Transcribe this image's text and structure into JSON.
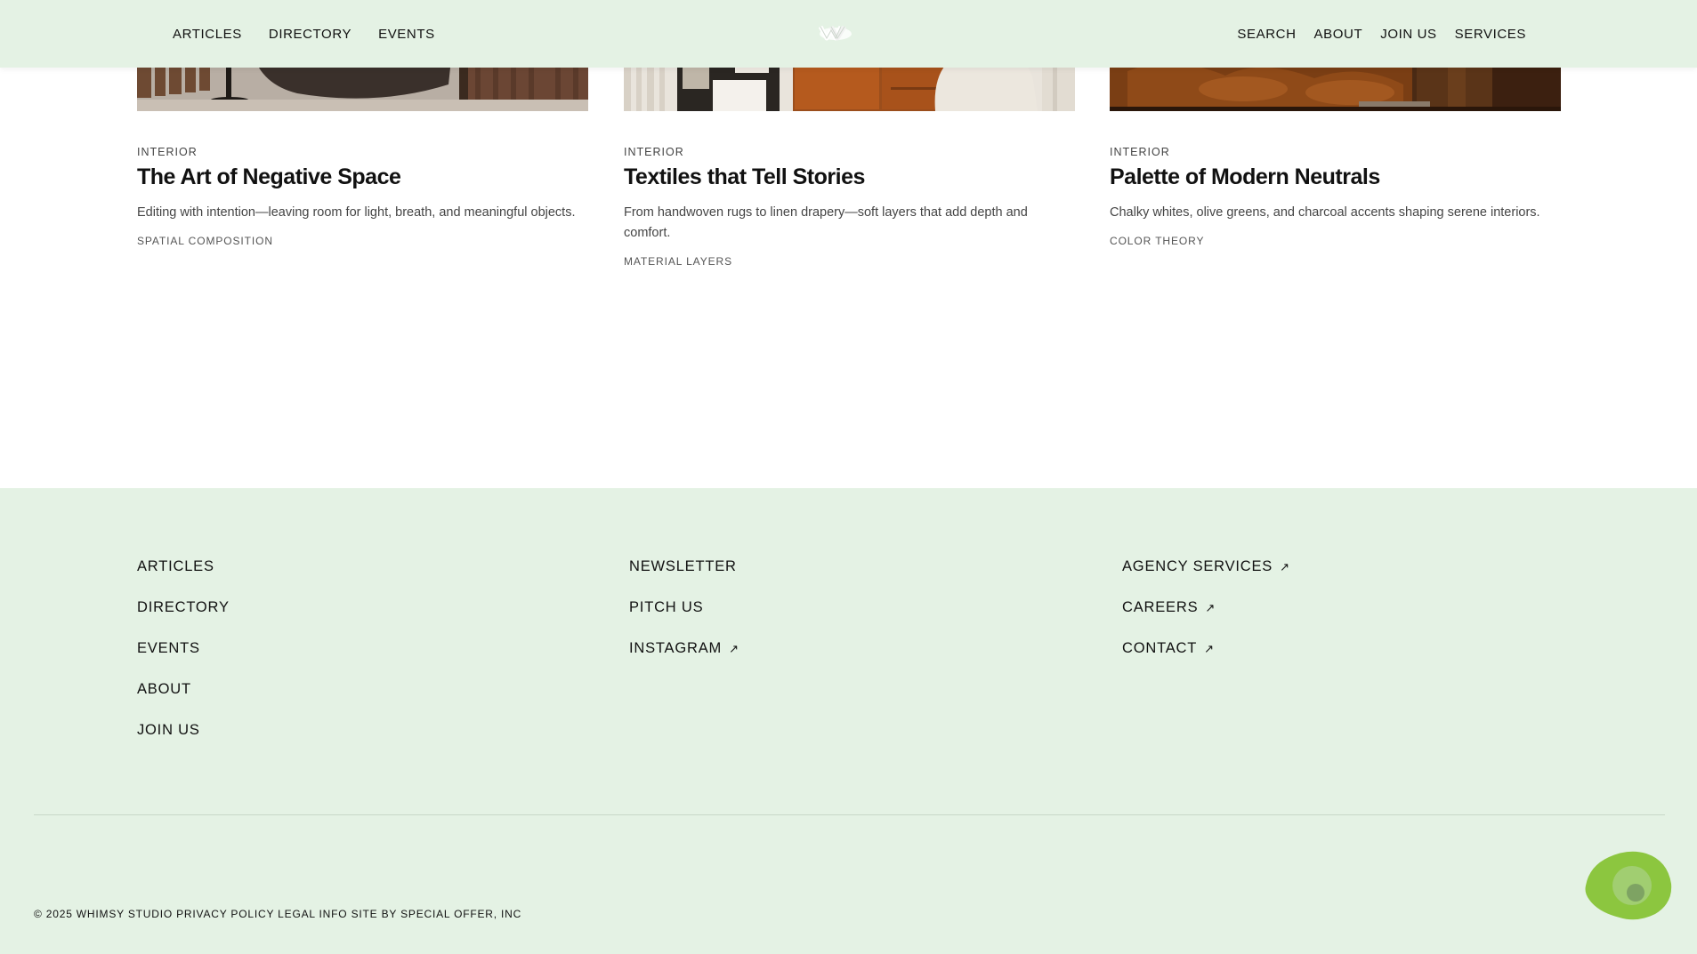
{
  "header": {
    "left_nav": [
      "ARTICLES",
      "DIRECTORY",
      "EVENTS"
    ],
    "right_nav": [
      "SEARCH",
      "ABOUT",
      "JOIN US",
      "SERVICES"
    ],
    "logo_icon": "w-monogram-logo"
  },
  "cards": [
    {
      "category": "INTERIOR",
      "title": "The Art of Negative Space",
      "description": "Editing with intention—leaving room for light, breath, and meaningful objects.",
      "tag": "SPATIAL COMPOSITION"
    },
    {
      "category": "INTERIOR",
      "title": "Textiles that Tell Stories",
      "description": "From handwoven rugs to linen drapery—soft layers that add depth and comfort.",
      "tag": "MATERIAL LAYERS"
    },
    {
      "category": "INTERIOR",
      "title": "Palette of Modern Neutrals",
      "description": "Chalky whites, olive greens, and charcoal accents shaping serene interiors.",
      "tag": "COLOR THEORY"
    }
  ],
  "footer": {
    "col1": [
      "ARTICLES",
      "DIRECTORY",
      "EVENTS",
      "ABOUT",
      "JOIN US"
    ],
    "col2": [
      "NEWSLETTER",
      "PITCH US",
      "INSTAGRAM"
    ],
    "col3": [
      "AGENCY SERVICES",
      "CAREERS",
      "CONTACT"
    ],
    "external_arrow": "↗",
    "legal": {
      "copyright": "© 2025 WHIMSY STUDIO",
      "privacy": "PRIVACY POLICY",
      "legal_info": "LEGAL INFO",
      "credit": "SITE BY SPECIAL OFFER, INC"
    }
  },
  "colors": {
    "mint_background": "#e4f2e4",
    "blob_green": "#8cc63f"
  }
}
